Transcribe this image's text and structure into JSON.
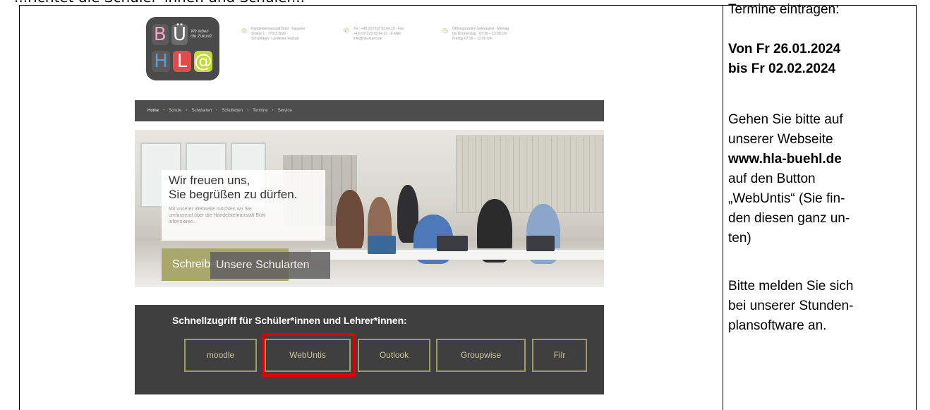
{
  "doc": {
    "clipped_heading": "...richtet die Schüler*innen und Schüler..."
  },
  "website": {
    "logo": {
      "letters": [
        "B",
        "Ü",
        "H",
        "L",
        "@"
      ],
      "slogan": "Wir leben die Zukunft"
    },
    "info": {
      "address": "Handelslehranstalt Bühl · Kasseler Straße 1 · 77815 Bühl · Schulträger: Landkreis Rastatt",
      "contact": "Tel.: +49 (0)7223 93 64 10 · Fax: +49 (0)7223 93 64 13 · E-Mail: info@hla-buehl.de",
      "hours": "Öffnungszeiten Sekretariat · Montag bis Donnerstag · 07:30 – 13:00 Uhr · Freitag 07:30 – 12:00 Uhr"
    },
    "nav": [
      "Home",
      "Schule",
      "Schularten",
      "Schulleben",
      "Termine",
      "Service"
    ],
    "hero": {
      "headline_1": "Wir freuen uns,",
      "headline_2": "Sie begrüßen zu dürfen.",
      "text": "Mit unserer Webseite möchten wir Sie umfassend über die Handelslehranstalt Bühl informieren.",
      "btn_schreiben": "Schreiben Sie",
      "btn_schularten": "Unsere Schularten"
    },
    "quick_access": {
      "title": "Schnellzugriff für Schüler*innen und Lehrer*innen:",
      "buttons": [
        "moodle",
        "WebUntis",
        "Outlook",
        "Groupwise",
        "Filr"
      ]
    }
  },
  "side": {
    "line1": "Termine eintragen:",
    "date_from": "Von Fr 26.01.2024",
    "date_to": "bis Fr 02.02.2024",
    "p1": "Gehen Sie bitte auf",
    "p2": "unserer Webseite",
    "url": "www.hla-buehl.de",
    "p3": "auf den Button",
    "p4": "„WebUntis“ (Sie fin-",
    "p5": "den diesen ganz un-",
    "p6": "ten)",
    "q1": "Bitte melden Sie sich",
    "q2": "bei unserer Stunden-",
    "q3": "plansoftware an."
  },
  "colors": {
    "accent_gold": "#a9a86c",
    "highlight_red": "#e00000",
    "dark_panel": "#3f3f3f"
  }
}
